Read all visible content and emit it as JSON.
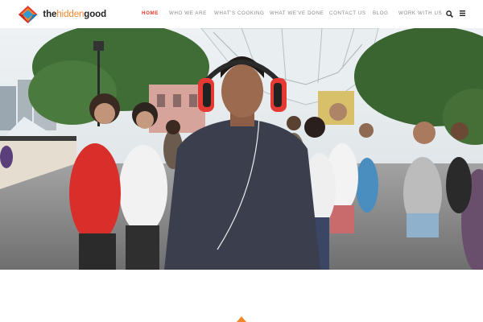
{
  "brand": {
    "name_part1": "the",
    "name_part2": "hidden",
    "name_part3": "good",
    "accent": "#f0862a",
    "logo_colors": [
      "#e3372e",
      "#f0862a",
      "#2d9ad6"
    ]
  },
  "nav": {
    "items": [
      {
        "label": "HOME",
        "active": true
      },
      {
        "label": "WHO WE ARE",
        "active": false
      },
      {
        "label": "WHAT'S COOKING",
        "active": false
      },
      {
        "label": "WHAT WE'VE DONE",
        "active": false
      },
      {
        "label": "CONTACT US",
        "active": false
      },
      {
        "label": "BLOG",
        "active": false
      },
      {
        "label": "WORK WITH US",
        "active": false
      }
    ],
    "active_color": "#e3372e",
    "icons": [
      "search-icon",
      "menu-icon"
    ]
  },
  "hero": {
    "colors": {
      "sky": "#dfe6ea",
      "trees": "#3e6b34",
      "road": "#8d8d8d",
      "shirt": "#3b3e4d",
      "headphones": "#e53a33"
    }
  },
  "section_marker": {
    "icon": "chevron-up-icon",
    "color": "#f0862a"
  }
}
